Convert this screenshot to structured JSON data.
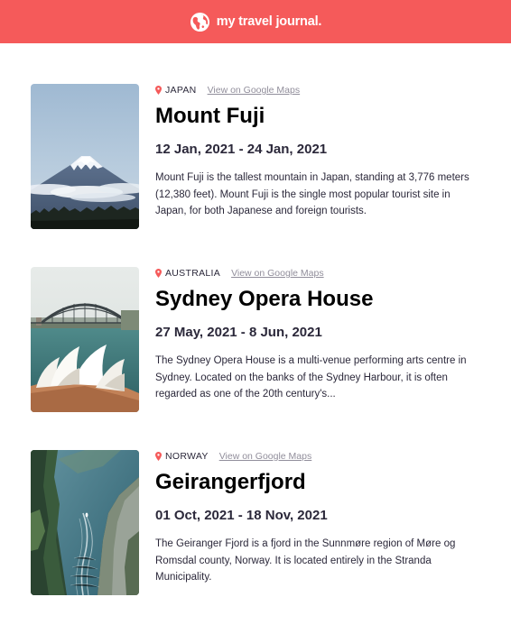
{
  "header": {
    "title": "my travel journal."
  },
  "entries": [
    {
      "location": "Japan",
      "maps_link": "View on Google Maps",
      "title": "Mount Fuji",
      "dates": "12 Jan, 2021 - 24 Jan, 2021",
      "description": "Mount Fuji is the tallest mountain in Japan, standing at 3,776 meters (12,380 feet). Mount Fuji is the single most popular tourist site in Japan, for both Japanese and foreign tourists."
    },
    {
      "location": "Australia",
      "maps_link": "View on Google Maps",
      "title": "Sydney Opera House",
      "dates": "27 May, 2021 - 8 Jun, 2021",
      "description": "The Sydney Opera House is a multi-venue performing arts centre in Sydney. Located on the banks of the Sydney Harbour, it is often regarded as one of the 20th century's..."
    },
    {
      "location": "Norway",
      "maps_link": "View on Google Maps",
      "title": "Geirangerfjord",
      "dates": "01 Oct, 2021 - 18 Nov, 2021",
      "description": "The Geiranger Fjord is a fjord in the Sunnmøre region of Møre og Romsdal county, Norway. It is located entirely in the Stranda Municipality."
    }
  ],
  "colors": {
    "header_bg": "#f55a5a",
    "pin": "#f55a5a",
    "title": "#000000",
    "body_text": "#2b283a",
    "link": "#918e9b"
  },
  "icons": {
    "logo": "globe-icon",
    "location": "map-pin-icon"
  }
}
